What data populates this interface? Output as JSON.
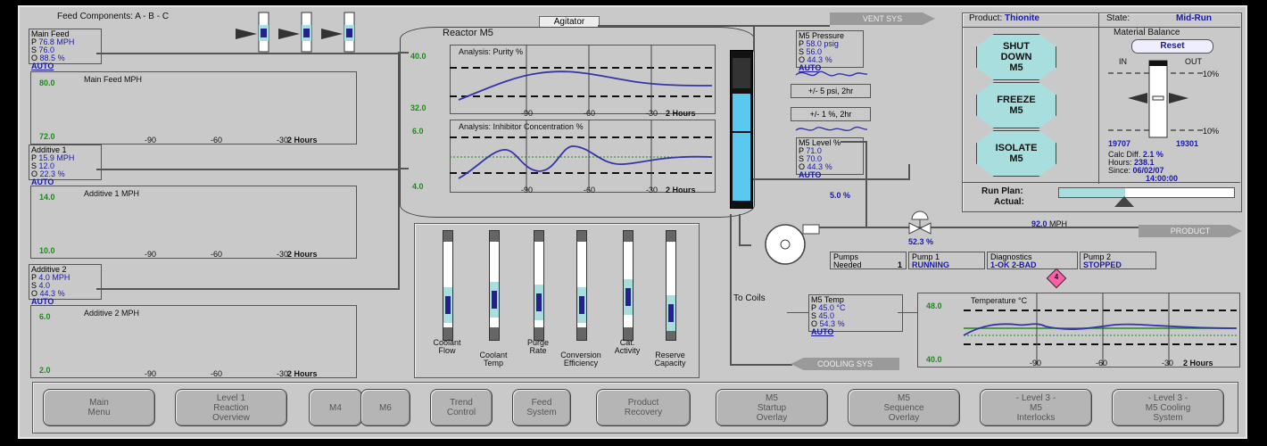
{
  "header": {
    "feed_components": "Feed Components: A - B - C"
  },
  "agitator": {
    "label": "Agitator",
    "state": "ON"
  },
  "reactor": {
    "label": "Reactor M5"
  },
  "vent_tag": "VENT SYS",
  "product_tag": "PRODUCT",
  "cooling_tag": "COOLING SYS",
  "to_coils": "To Coils",
  "feeds": [
    {
      "title": "Main Feed",
      "p": "76.8",
      "p_unit": "MPH",
      "s": "76.0",
      "o": "88.5",
      "o_unit": "%",
      "mode": "AUTO",
      "trend_title": "Main Feed  MPH",
      "ymax": "80.0",
      "ymin": "72.0",
      "ticks": [
        "-90",
        "-60",
        "-30"
      ],
      "hours": "2 Hours"
    },
    {
      "title": "Additive 1",
      "p": "15.9",
      "p_unit": "MPH",
      "s": "12.0",
      "o": "22.3",
      "o_unit": "%",
      "mode": "AUTO",
      "trend_title": "Additive 1  MPH",
      "ymax": "14.0",
      "ymin": "10.0",
      "ticks": [
        "-90",
        "-60",
        "-30"
      ],
      "hours": "2 Hours"
    },
    {
      "title": "Additive 2",
      "p": "4.0",
      "p_unit": "MPH",
      "s": "4.0",
      "o": "44.3",
      "o_unit": "%",
      "mode": "AUTO",
      "trend_title": "Additive 2  MPH",
      "ymax": "6.0",
      "ymin": "2.0",
      "ticks": [
        "-90",
        "-60",
        "-30"
      ],
      "hours": "2 Hours"
    }
  ],
  "purity": {
    "title": "Analysis: Purity  %",
    "ymax": "40.0",
    "ymin": "32.0",
    "ticks": [
      "-90",
      "-60",
      "-30"
    ],
    "hours": "2 Hours"
  },
  "inhibitor": {
    "title": "Analysis: Inhibitor Concentration  %",
    "ymax": "6.0",
    "ymin": "4.0",
    "ticks": [
      "-90",
      "-60",
      "-30"
    ],
    "hours": "2 Hours"
  },
  "pressure": {
    "title": "M5 Pressure",
    "p": "58.0",
    "p_unit": "psig",
    "s": "56.0",
    "o": "44.3",
    "o_unit": "%",
    "mode": "AUTO",
    "range_label": "+/- 5 psi, 2hr"
  },
  "level": {
    "title": "M5 Level %",
    "p": "71.0",
    "s": "70.0",
    "o": "44.3",
    "o_unit": "%",
    "mode": "AUTO",
    "range_label": "+/- 1 %,  2hr"
  },
  "cooling_valve": {
    "pct": "5.0",
    "unit": "%"
  },
  "product_flow": {
    "value": "92.0",
    "unit": "MPH",
    "valve_pct": "52.3",
    "valve_unit": "%"
  },
  "pumps": [
    {
      "label": "Pumps\nNeeded",
      "value": "1"
    },
    {
      "label": "Pump 1",
      "value": "RUNNING"
    },
    {
      "label": "Diagnostics",
      "value": "1-OK  2-BAD"
    },
    {
      "label": "Pump 2",
      "value": "STOPPED"
    }
  ],
  "alarm_count": "4",
  "temp": {
    "title": "M5 Temp",
    "p": "45.0",
    "p_unit": "°C",
    "s": "45.0",
    "o": "54.3",
    "o_unit": "%",
    "mode": "AUTO",
    "trend_title": "Temperature  °C",
    "ymax": "48.0",
    "ymin": "40.0",
    "ticks": [
      "-90",
      "-60",
      "-30"
    ],
    "hours": "2 Hours"
  },
  "gauges": [
    {
      "label": "Coolant\nFlow",
      "fill": 0.45
    },
    {
      "label": "Coolant\nTemp",
      "fill": 0.55
    },
    {
      "label": "Purge\nRate",
      "fill": 0.5
    },
    {
      "label": "Conversion\nEfficiency",
      "fill": 0.45
    },
    {
      "label": "Cat.\nActivity",
      "fill": 0.6
    },
    {
      "label": "Reserve\nCapacity",
      "fill": 0.3
    }
  ],
  "product_panel": {
    "product_label": "Product:",
    "product": "Thionite",
    "state_label": "State:",
    "state": "Mid-Run"
  },
  "actions": [
    {
      "label": "SHUT\nDOWN\nM5"
    },
    {
      "label": "FREEZE\nM5"
    },
    {
      "label": "ISOLATE\nM5"
    }
  ],
  "material_balance": {
    "title": "Material Balance",
    "reset": "Reset",
    "in_label": "IN",
    "out_label": "OUT",
    "pct_high": "10%",
    "pct_low": "10%",
    "in_value": "19707",
    "out_value": "19301",
    "calc_diff_label": "Calc Diff.",
    "calc_diff": "2.1 %",
    "hours_label": "Hours:",
    "hours": "238.1",
    "since_label": "Since:",
    "since_date": "06/02/07",
    "since_time": "14:00:00"
  },
  "run_plan": {
    "label": "Run Plan:",
    "actual_label": "Actual:",
    "progress": 0.38
  },
  "nav": [
    {
      "label": "Main\nMenu"
    },
    {
      "label": "Level 1\nReaction\nOverview"
    },
    {
      "label": "M4"
    },
    {
      "label": "M6"
    },
    {
      "label": "Trend\nControl"
    },
    {
      "label": "Feed\nSystem"
    },
    {
      "label": "Product\nRecovery"
    },
    {
      "label": "M5\nStartup\nOverlay"
    },
    {
      "label": "M5\nSequence\nOverlay"
    },
    {
      "label": "- Level 3 -\nM5\nInterlocks"
    },
    {
      "label": "- Level 3 -\nM5 Cooling\nSystem"
    }
  ],
  "colors": {
    "bg": "#c9c9c9",
    "value_blue": "#1a1aa6",
    "trend_blue": "#3535a8",
    "trend_green": "#1d8a1d",
    "octagon": "#a9dede",
    "level_fill": "#5bc8f0"
  }
}
